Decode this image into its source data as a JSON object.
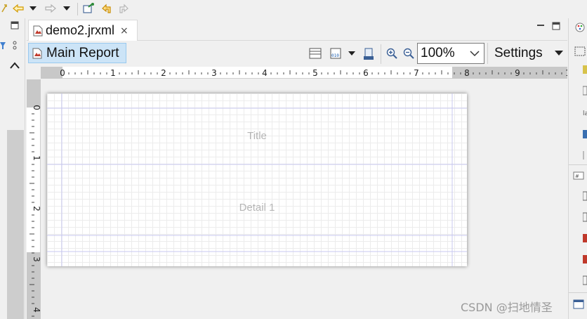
{
  "editor": {
    "tab_title": "demo2.jrxml",
    "tab_close_glyph": "×",
    "main_report_label": "Main Report",
    "zoom_value": "100%",
    "settings_label": "Settings"
  },
  "rulers": {
    "horizontal_ticks": [
      "0",
      "1",
      "2",
      "3",
      "4",
      "5",
      "6",
      "7",
      "8",
      "9",
      "1"
    ],
    "vertical_ticks": [
      "0",
      "1",
      "2",
      "3",
      "4"
    ]
  },
  "report": {
    "bands": [
      "Title",
      "Detail 1"
    ]
  },
  "watermark": "CSDN @扫地情圣",
  "icons": {
    "top_toolbar": [
      "pin-back-icon",
      "back-arrow-icon",
      "dropdown-arrow-icon",
      "forward-arrow-icon",
      "dropdown-arrow-icon",
      "external-tools-icon",
      "undo-icon",
      "redo-icon"
    ],
    "editor_toolbar": [
      "layout-icon",
      "preview-icon",
      "dropdown-arrow-icon",
      "export-icon",
      "zoom-in-icon",
      "zoom-out-icon"
    ]
  },
  "colors": {
    "selection_bg": "#cce4f7",
    "selection_border": "#99c9ef",
    "band_line": "#c8c8f0",
    "band_label": "#b5b5b5"
  }
}
